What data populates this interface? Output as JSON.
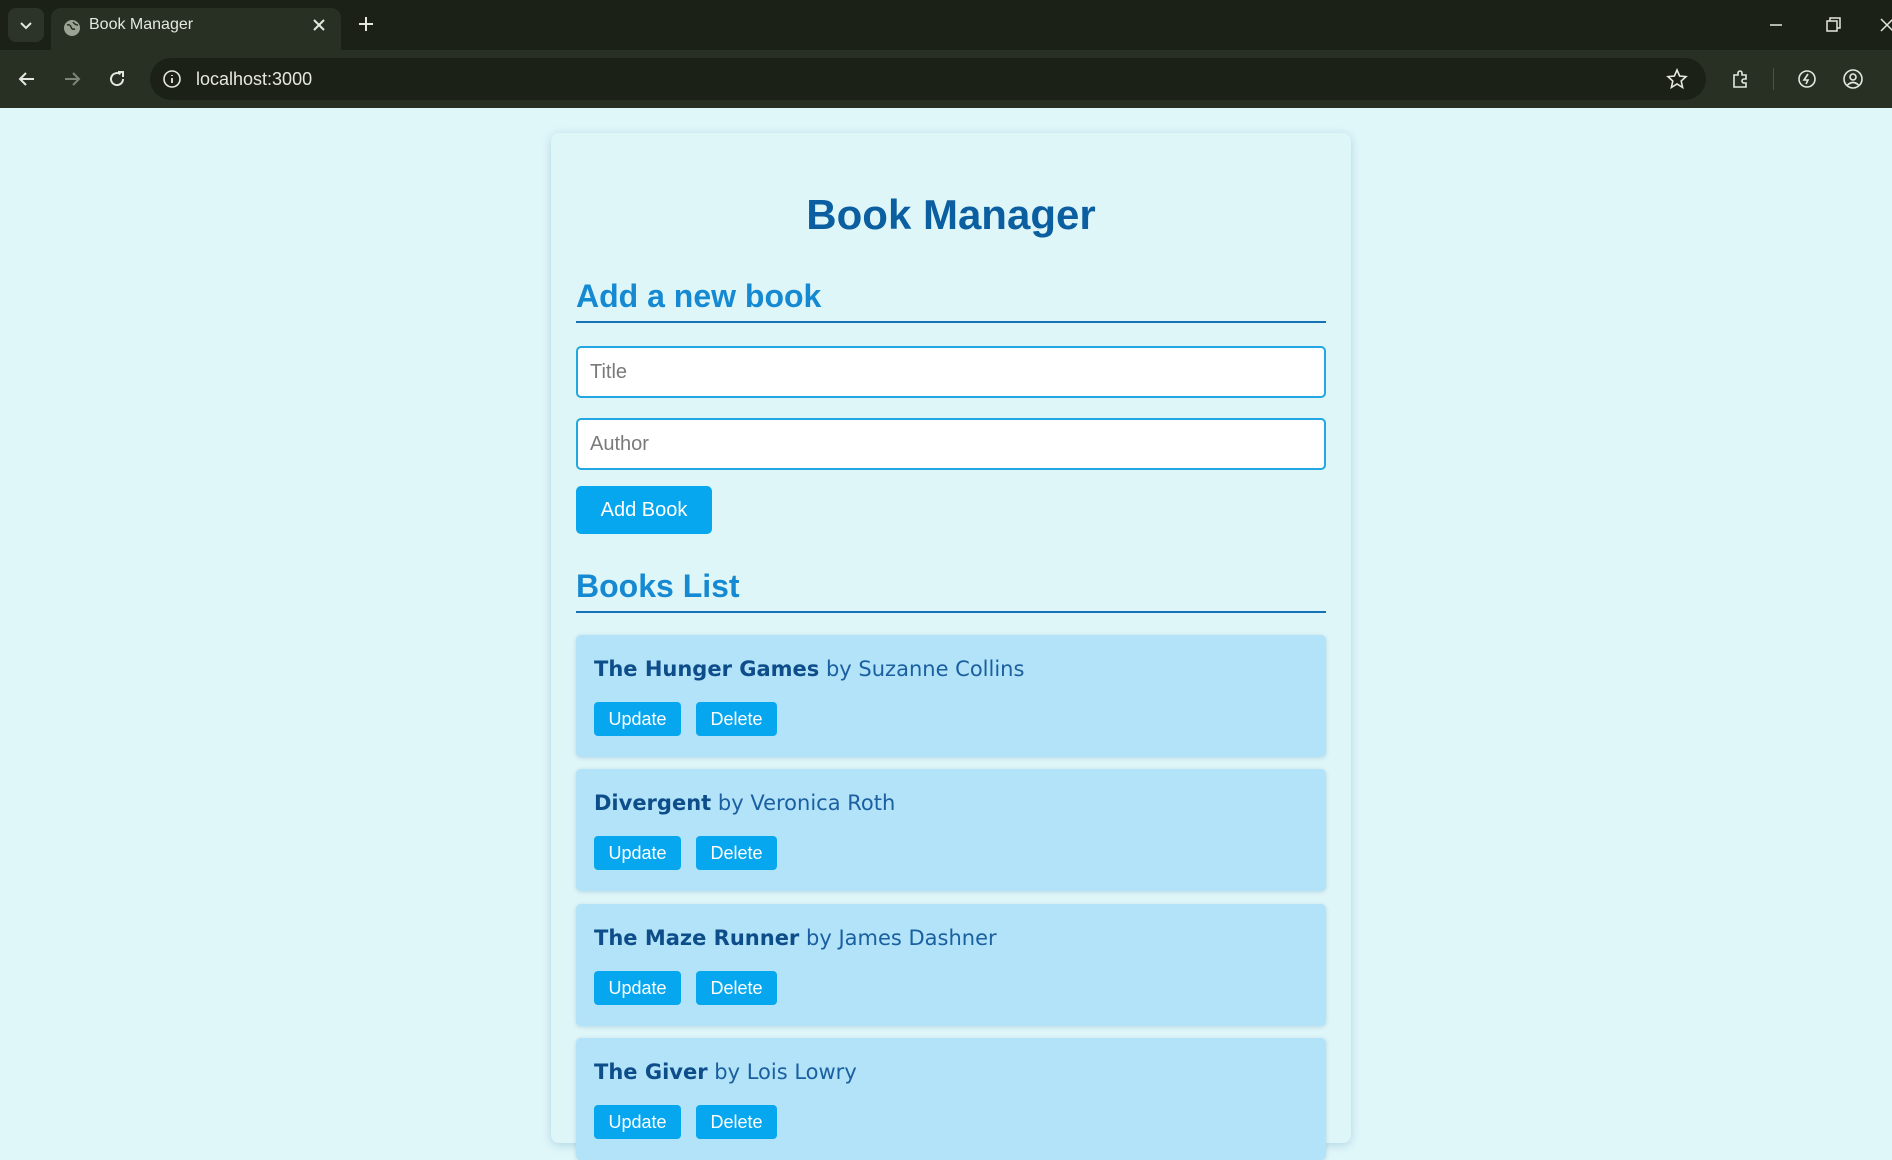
{
  "browser": {
    "tab_title": "Book Manager",
    "url": "localhost:3000"
  },
  "page": {
    "title": "Book Manager",
    "add_section": {
      "heading": "Add a new book",
      "title_placeholder": "Title",
      "author_placeholder": "Author",
      "add_button": "Add Book"
    },
    "list_section": {
      "heading": "Books List",
      "books": [
        {
          "title": "The Hunger Games",
          "by": "by",
          "author": "Suzanne Collins",
          "update": "Update",
          "delete": "Delete"
        },
        {
          "title": "Divergent",
          "by": "by",
          "author": "Veronica Roth",
          "update": "Update",
          "delete": "Delete"
        },
        {
          "title": "The Maze Runner",
          "by": "by",
          "author": "James Dashner",
          "update": "Update",
          "delete": "Delete"
        },
        {
          "title": "The Giver",
          "by": "by",
          "author": "Lois Lowry",
          "update": "Update",
          "delete": "Delete"
        }
      ]
    }
  },
  "colors": {
    "page_background": "#e0f7fa",
    "accent": "#07a7ef",
    "title": "#0b5fa0",
    "heading": "#1589d1",
    "book_card": "#b2e3f8"
  }
}
